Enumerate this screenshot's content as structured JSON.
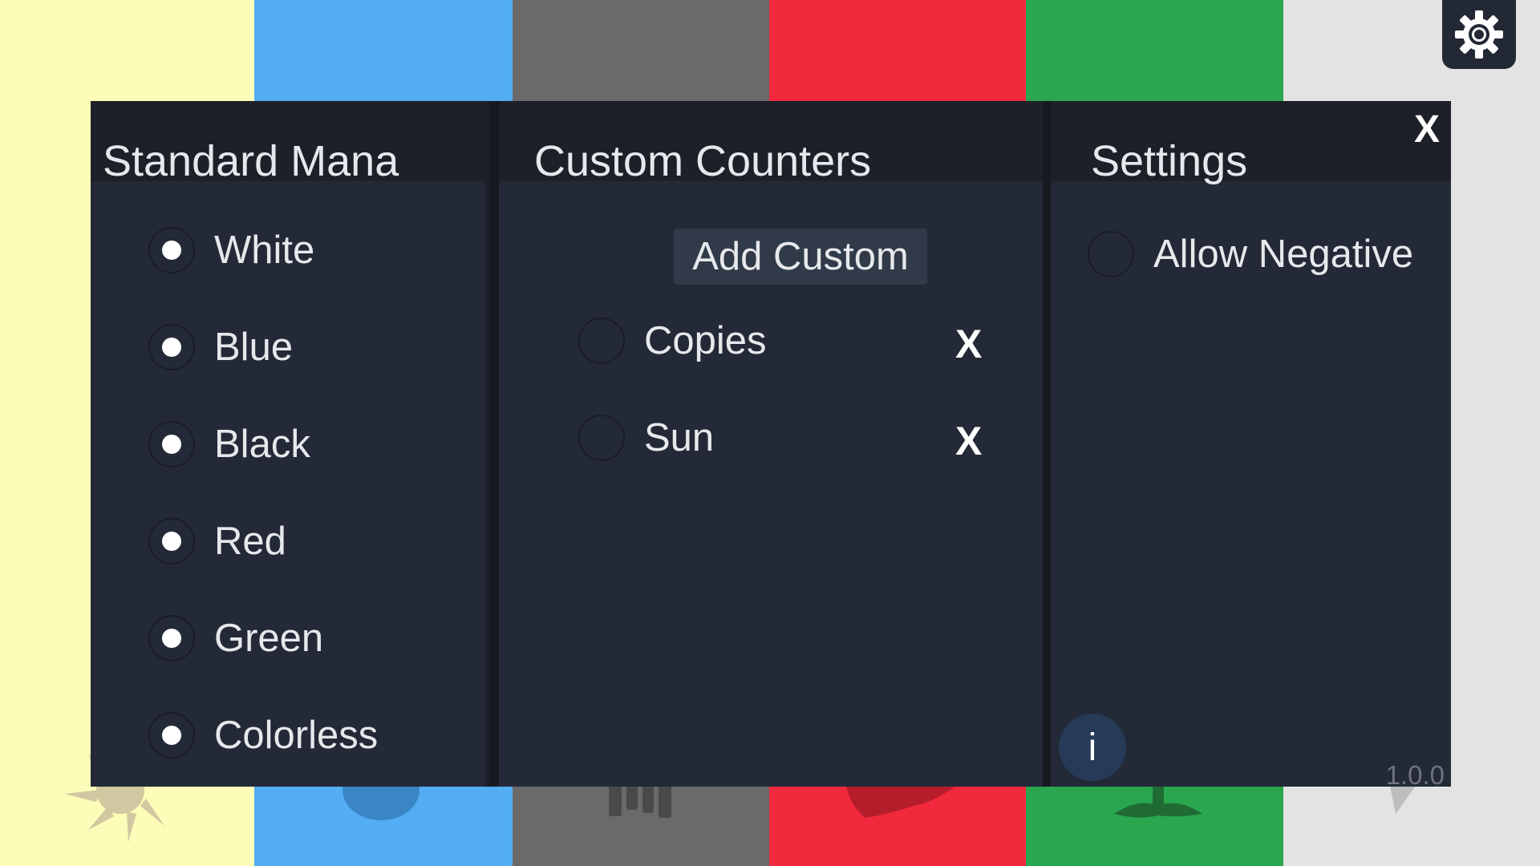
{
  "background": {
    "stripes": [
      {
        "name": "white",
        "color": "#fdfcb8",
        "symbol": "sun-symbol-icon"
      },
      {
        "name": "blue",
        "color": "#52adf3",
        "symbol": "water-drop-symbol-icon"
      },
      {
        "name": "black",
        "color": "#6a6a6a",
        "symbol": "skull-symbol-icon"
      },
      {
        "name": "red",
        "color": "#f0293d",
        "symbol": "fire-symbol-icon"
      },
      {
        "name": "green",
        "color": "#29a64e",
        "symbol": "tree-symbol-icon"
      },
      {
        "name": "colorless",
        "color": "#e3e3e3",
        "symbol": "diamond-symbol-icon"
      }
    ]
  },
  "header": {
    "settings_icon": "gear-icon"
  },
  "modal": {
    "close_label": "X",
    "standard_mana": {
      "title": "Standard Mana",
      "items": [
        {
          "label": "White",
          "checked": true
        },
        {
          "label": "Blue",
          "checked": true
        },
        {
          "label": "Black",
          "checked": true
        },
        {
          "label": "Red",
          "checked": true
        },
        {
          "label": "Green",
          "checked": true
        },
        {
          "label": "Colorless",
          "checked": true
        }
      ]
    },
    "custom_counters": {
      "title": "Custom Counters",
      "add_label": "Add Custom",
      "items": [
        {
          "label": "Copies",
          "checked": false,
          "remove_label": "X"
        },
        {
          "label": "Sun",
          "checked": false,
          "remove_label": "X"
        }
      ]
    },
    "settings": {
      "title": "Settings",
      "items": [
        {
          "label": "Allow Negative",
          "checked": false
        }
      ],
      "info_label": "i",
      "version": "1.0.0"
    }
  },
  "colors": {
    "panel": "#232937",
    "panel_header": "#1d2029",
    "button": "#313a48",
    "info_button": "#263b57",
    "text": "#e6e8ec"
  }
}
